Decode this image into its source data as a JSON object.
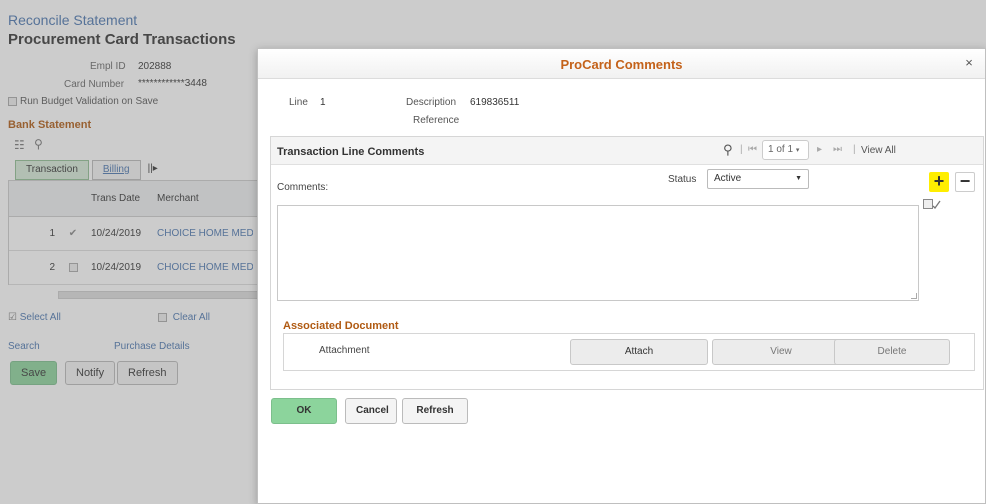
{
  "background": {
    "breadcrumb": "Reconcile Statement",
    "page_title": "Procurement Card Transactions",
    "empl_id_label": "Empl ID",
    "empl_id_value": "202888",
    "card_number_label": "Card Number",
    "card_number_value": "************3448",
    "budget_validation_label": "Run Budget Validation on Save",
    "section_title": "Bank Statement",
    "tabs": [
      {
        "label": "Transaction",
        "active": true
      },
      {
        "label": "Billing",
        "active": false
      }
    ],
    "tab_more": "||▸",
    "grid": {
      "headers": [
        "",
        "",
        "Trans Date",
        "Merchant"
      ],
      "rows": [
        {
          "num": "1",
          "checked": true,
          "date": "10/24/2019",
          "merchant": "CHOICE HOME MEDI"
        },
        {
          "num": "2",
          "checked": false,
          "date": "10/24/2019",
          "merchant": "CHOICE HOME MEDI"
        }
      ]
    },
    "select_all": "Select All",
    "clear_all": "Clear All",
    "search_link": "Search",
    "purchase_details_link": "Purchase Details",
    "buttons": {
      "save": "Save",
      "notify": "Notify",
      "refresh": "Refresh"
    }
  },
  "modal": {
    "title": "ProCard Comments",
    "close_glyph": "×",
    "line_label": "Line",
    "line_value": "1",
    "description_label": "Description",
    "description_value": "619836511",
    "reference_label": "Reference",
    "comments_section": {
      "title": "Transaction Line Comments",
      "pager_text": "1 of 1",
      "view_all": "View All",
      "comments_label": "Comments:",
      "comments_value": "",
      "status_label": "Status",
      "status_value": "Active",
      "add_glyph": "+",
      "delete_glyph": "−"
    },
    "associated_document": {
      "title": "Associated Document",
      "attachment_label": "Attachment",
      "attach_button": "Attach",
      "view_button": "View",
      "delete_button": "Delete"
    },
    "buttons": {
      "ok": "OK",
      "cancel": "Cancel",
      "refresh": "Refresh"
    }
  },
  "colors": {
    "section_title": "#b05a12",
    "modal_title": "#c4621a",
    "link": "#4a76b0",
    "primary_button": "#8cd49c",
    "add_highlight": "#ffee00"
  }
}
